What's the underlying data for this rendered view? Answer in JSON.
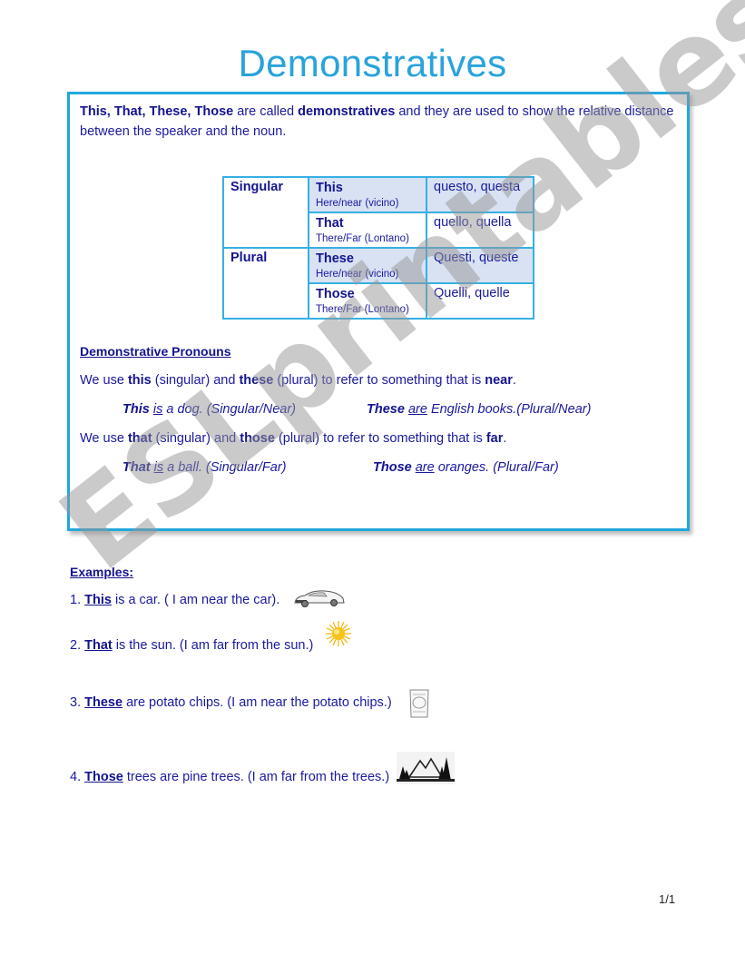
{
  "document": {
    "title": "Demonstratives",
    "page_indicator": "1/1",
    "watermark": "ESLprintables.com"
  },
  "intro": {
    "bold_words": "This, That, These, Those",
    "text_1": " are called ",
    "bold_term": "demonstratives",
    "text_2": " and they are used to show the relative distance between the speaker and the noun."
  },
  "table": {
    "rows": [
      {
        "group": "Singular",
        "word": "This",
        "hint": "Here/near (vicino)",
        "italian": "questo, questa",
        "shaded": true
      },
      {
        "group": "",
        "word": "That",
        "hint": "There/Far (Lontano)",
        "italian": "quello, quella",
        "shaded": false
      },
      {
        "group": "Plural",
        "word": "These",
        "hint": "Here/near (vicino)",
        "italian": "Questi, queste",
        "shaded": true
      },
      {
        "group": "",
        "word": "Those",
        "hint": "There/Far (Lontano)",
        "italian": "Quelli, quelle",
        "shaded": false
      }
    ]
  },
  "pronouns": {
    "heading": "Demonstrative Pronouns",
    "near_rule": {
      "p1": "We use ",
      "w1": "this",
      "p2": " (singular) and ",
      "w2": "these",
      "p3": " (plural) to refer to something that is ",
      "w3": "near",
      "p4": "."
    },
    "near_examples": [
      {
        "subject": "This",
        "verb": "is",
        "rest": " a dog. (Singular/Near)"
      },
      {
        "subject": "These",
        "verb": "are",
        "rest": " English books.(Plural/Near)"
      }
    ],
    "far_rule": {
      "p1": "We use ",
      "w1": "that",
      "p2": " (singular) and ",
      "w2": "those",
      "p3": " (plural) to refer to something that is ",
      "w3": "far",
      "p4": "."
    },
    "far_examples": [
      {
        "subject": "That",
        "verb": "is",
        "rest": " a ball.  (Singular/Far)"
      },
      {
        "subject": "Those",
        "verb": "are",
        "rest": " oranges. (Plural/Far)"
      }
    ]
  },
  "examples": {
    "heading": "Examples:",
    "items": [
      {
        "num": "1. ",
        "keyword": "This",
        "rest": " is a car. ( I am near the car).",
        "icon": "car-icon"
      },
      {
        "num": "2. ",
        "keyword": "That",
        "rest": " is the sun. (I am far from the sun.)",
        "icon": "sun-icon"
      },
      {
        "num": "3. ",
        "keyword": "These",
        "rest": " are potato chips. (I am near the potato chips.)",
        "icon": "chips-bag-icon"
      },
      {
        "num": "4. ",
        "keyword": "Those",
        "rest": " trees are pine trees. (I am far from the trees.)",
        "icon": "pine-trees-icon"
      }
    ]
  }
}
